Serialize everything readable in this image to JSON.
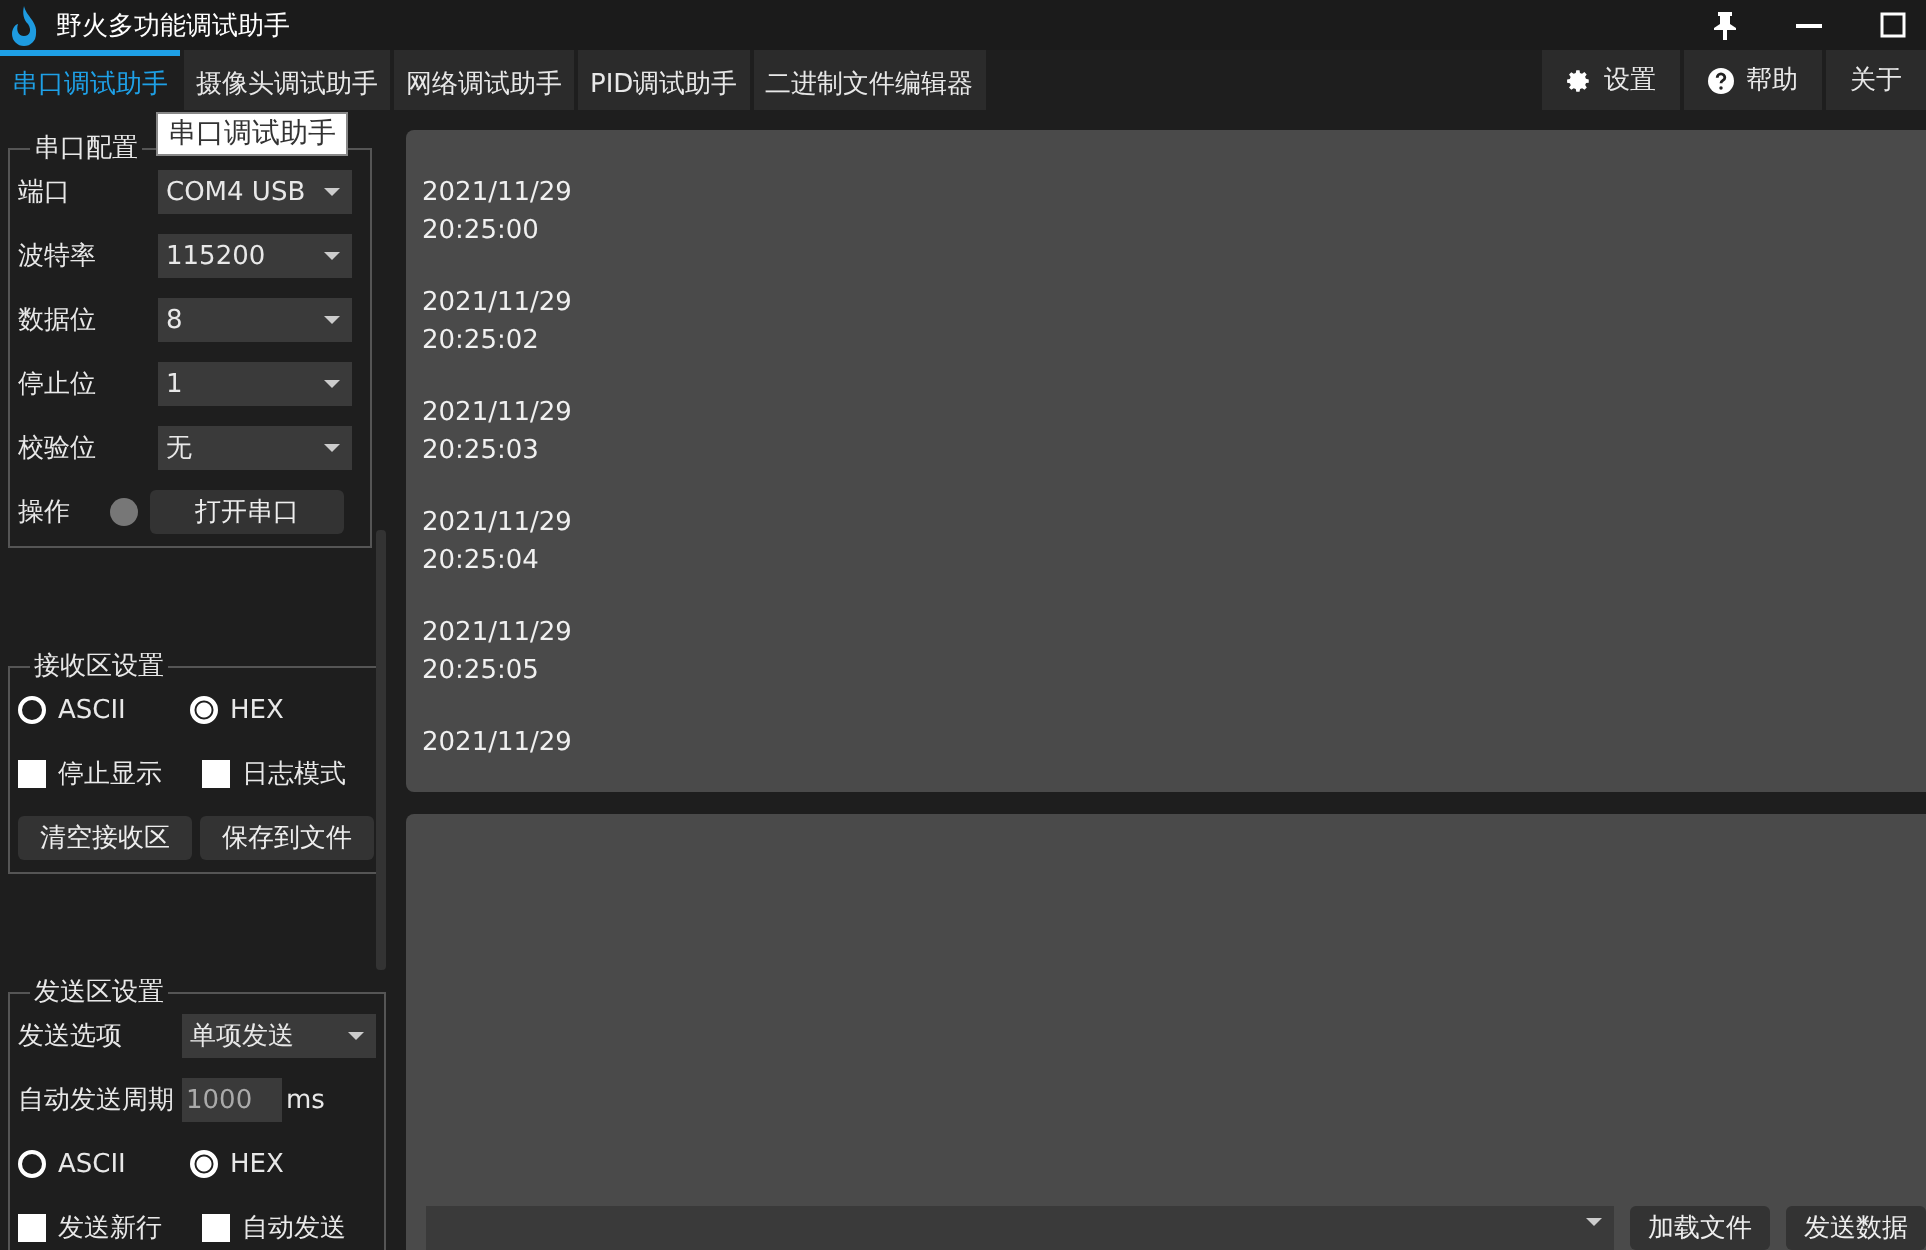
{
  "window": {
    "title": "野火多功能调试助手"
  },
  "tabs": [
    {
      "label": "串口调试助手",
      "selected": true
    },
    {
      "label": "摄像头调试助手",
      "selected": false
    },
    {
      "label": "网络调试助手",
      "selected": false
    },
    {
      "label": "PID调试助手",
      "selected": false
    },
    {
      "label": "二进制文件编辑器",
      "selected": false
    }
  ],
  "tooltip": "串口调试助手",
  "right_tabs": [
    {
      "kind": "gear",
      "label": "设置"
    },
    {
      "kind": "help",
      "label": "帮助"
    },
    {
      "kind": "none",
      "label": "关于"
    }
  ],
  "serial_config": {
    "title": "串口配置",
    "fields": [
      {
        "label": "端口",
        "value": "COM4 USB"
      },
      {
        "label": "波特率",
        "value": "115200"
      },
      {
        "label": "数据位",
        "value": "8"
      },
      {
        "label": "停止位",
        "value": "1"
      },
      {
        "label": "校验位",
        "value": "无"
      }
    ],
    "action_label": "操作",
    "port_open": false,
    "open_button": "打开串口"
  },
  "receive_settings": {
    "title": "接收区设置",
    "modes": [
      {
        "label": "ASCII",
        "selected": false
      },
      {
        "label": "HEX",
        "selected": true
      }
    ],
    "options": [
      {
        "label": "停止显示",
        "checked": false
      },
      {
        "label": "日志模式",
        "checked": false
      }
    ],
    "buttons": [
      "清空接收区",
      "保存到文件"
    ]
  },
  "send_settings": {
    "title": "发送区设置",
    "option_label": "发送选项",
    "option_value": "单项发送",
    "period_label": "自动发送周期",
    "period_value": "1000",
    "period_unit": "ms",
    "modes": [
      {
        "label": "ASCII",
        "selected": false
      },
      {
        "label": "HEX",
        "selected": true
      }
    ],
    "options": [
      {
        "label": "发送新行",
        "checked": false
      },
      {
        "label": "自动发送",
        "checked": false
      }
    ]
  },
  "receive_log": [
    {
      "date": "2021/11/29",
      "time": "20:25:00"
    },
    {
      "date": "2021/11/29",
      "time": "20:25:02"
    },
    {
      "date": "2021/11/29",
      "time": "20:25:03"
    },
    {
      "date": "2021/11/29",
      "time": "20:25:04"
    },
    {
      "date": "2021/11/29",
      "time": "20:25:05"
    },
    {
      "date": "2021/11/29"
    }
  ],
  "send_buttons": [
    "加载文件",
    "发送数据"
  ]
}
